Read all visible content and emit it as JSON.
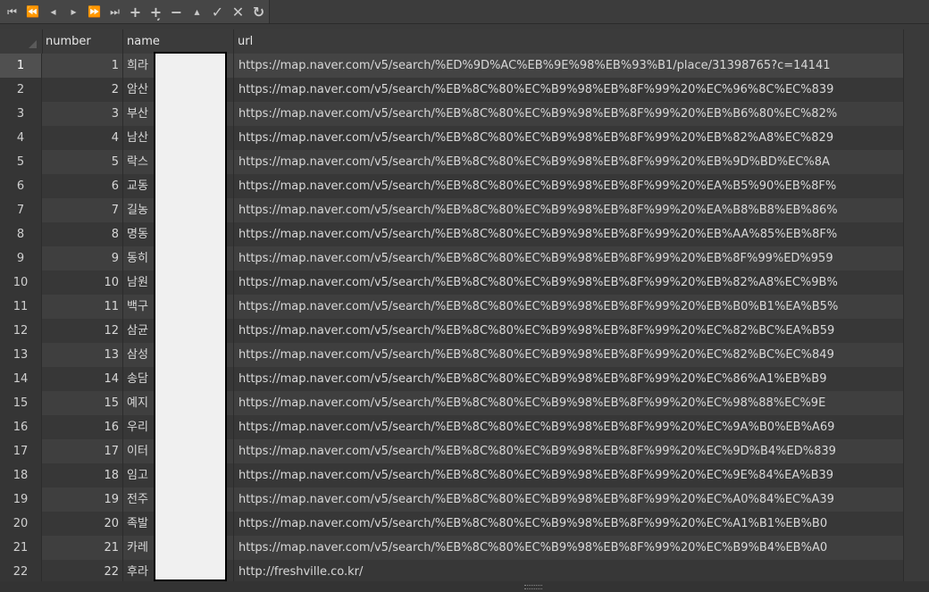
{
  "toolbar": {
    "buttons": [
      {
        "name": "first-page-button",
        "glyph": "⏮"
      },
      {
        "name": "prev-page-button",
        "glyph": "⏪"
      },
      {
        "name": "prev-record-button",
        "glyph": "◂"
      },
      {
        "name": "next-record-button",
        "glyph": "▸"
      },
      {
        "name": "next-page-button",
        "glyph": "⏩"
      },
      {
        "name": "last-record-button",
        "glyph": "⏭"
      },
      {
        "name": "add-record-button",
        "glyph": "+"
      },
      {
        "name": "insert-record-button",
        "glyph": "+̦"
      },
      {
        "name": "delete-record-button",
        "glyph": "−"
      },
      {
        "name": "move-up-button",
        "glyph": "▴"
      },
      {
        "name": "apply-button",
        "glyph": "✓"
      },
      {
        "name": "cancel-button",
        "glyph": "✕"
      },
      {
        "name": "refresh-button",
        "glyph": "↻"
      }
    ]
  },
  "columns": [
    "number",
    "name",
    "url"
  ],
  "rows": [
    {
      "row": "1",
      "number": "1",
      "name": "희라",
      "url": "https://map.naver.com/v5/search/%ED%9D%AC%EB%9E%98%EB%93%B1/place/31398765?c=14141"
    },
    {
      "row": "2",
      "number": "2",
      "name": "암산",
      "url": "https://map.naver.com/v5/search/%EB%8C%80%EC%B9%98%EB%8F%99%20%EC%96%8C%EC%839"
    },
    {
      "row": "3",
      "number": "3",
      "name": "부산",
      "url": "https://map.naver.com/v5/search/%EB%8C%80%EC%B9%98%EB%8F%99%20%EB%B6%80%EC%82%"
    },
    {
      "row": "4",
      "number": "4",
      "name": "남산",
      "url": "https://map.naver.com/v5/search/%EB%8C%80%EC%B9%98%EB%8F%99%20%EB%82%A8%EC%829"
    },
    {
      "row": "5",
      "number": "5",
      "name": "락스",
      "url": "https://map.naver.com/v5/search/%EB%8C%80%EC%B9%98%EB%8F%99%20%EB%9D%BD%EC%8A"
    },
    {
      "row": "6",
      "number": "6",
      "name": "교동",
      "url": "https://map.naver.com/v5/search/%EB%8C%80%EC%B9%98%EB%8F%99%20%EA%B5%90%EB%8F%"
    },
    {
      "row": "7",
      "number": "7",
      "name": "길농",
      "url": "https://map.naver.com/v5/search/%EB%8C%80%EC%B9%98%EB%8F%99%20%EA%B8%B8%EB%86%"
    },
    {
      "row": "8",
      "number": "8",
      "name": "명동",
      "url": "https://map.naver.com/v5/search/%EB%8C%80%EC%B9%98%EB%8F%99%20%EB%AA%85%EB%8F%"
    },
    {
      "row": "9",
      "number": "9",
      "name": "동히",
      "url": "https://map.naver.com/v5/search/%EB%8C%80%EC%B9%98%EB%8F%99%20%EB%8F%99%ED%959"
    },
    {
      "row": "10",
      "number": "10",
      "name": "남원",
      "url": "https://map.naver.com/v5/search/%EB%8C%80%EC%B9%98%EB%8F%99%20%EB%82%A8%EC%9B%"
    },
    {
      "row": "11",
      "number": "11",
      "name": "백구",
      "url": "https://map.naver.com/v5/search/%EB%8C%80%EC%B9%98%EB%8F%99%20%EB%B0%B1%EA%B5%"
    },
    {
      "row": "12",
      "number": "12",
      "name": "삼균",
      "url": "https://map.naver.com/v5/search/%EB%8C%80%EC%B9%98%EB%8F%99%20%EC%82%BC%EA%B59"
    },
    {
      "row": "13",
      "number": "13",
      "name": "삼성",
      "url": "https://map.naver.com/v5/search/%EB%8C%80%EC%B9%98%EB%8F%99%20%EC%82%BC%EC%849"
    },
    {
      "row": "14",
      "number": "14",
      "name": "송담",
      "url": "https://map.naver.com/v5/search/%EB%8C%80%EC%B9%98%EB%8F%99%20%EC%86%A1%EB%B9"
    },
    {
      "row": "15",
      "number": "15",
      "name": "예지",
      "url": "https://map.naver.com/v5/search/%EB%8C%80%EC%B9%98%EB%8F%99%20%EC%98%88%EC%9E"
    },
    {
      "row": "16",
      "number": "16",
      "name": "우리",
      "url": "https://map.naver.com/v5/search/%EB%8C%80%EC%B9%98%EB%8F%99%20%EC%9A%B0%EB%A69"
    },
    {
      "row": "17",
      "number": "17",
      "name": "이터",
      "url": "https://map.naver.com/v5/search/%EB%8C%80%EC%B9%98%EB%8F%99%20%EC%9D%B4%ED%839"
    },
    {
      "row": "18",
      "number": "18",
      "name": "임고",
      "url": "https://map.naver.com/v5/search/%EB%8C%80%EC%B9%98%EB%8F%99%20%EC%9E%84%EA%B39"
    },
    {
      "row": "19",
      "number": "19",
      "name": "전주",
      "url": "https://map.naver.com/v5/search/%EB%8C%80%EC%B9%98%EB%8F%99%20%EC%A0%84%EC%A39"
    },
    {
      "row": "20",
      "number": "20",
      "name": "족발",
      "url": "https://map.naver.com/v5/search/%EB%8C%80%EC%B9%98%EB%8F%99%20%EC%A1%B1%EB%B0"
    },
    {
      "row": "21",
      "number": "21",
      "name": "카레",
      "url": "https://map.naver.com/v5/search/%EB%8C%80%EC%B9%98%EB%8F%99%20%EC%B9%B4%EB%A0"
    },
    {
      "row": "22",
      "number": "22",
      "name": "후라",
      "url": "http://freshville.co.kr/"
    }
  ],
  "selected_row": "1"
}
